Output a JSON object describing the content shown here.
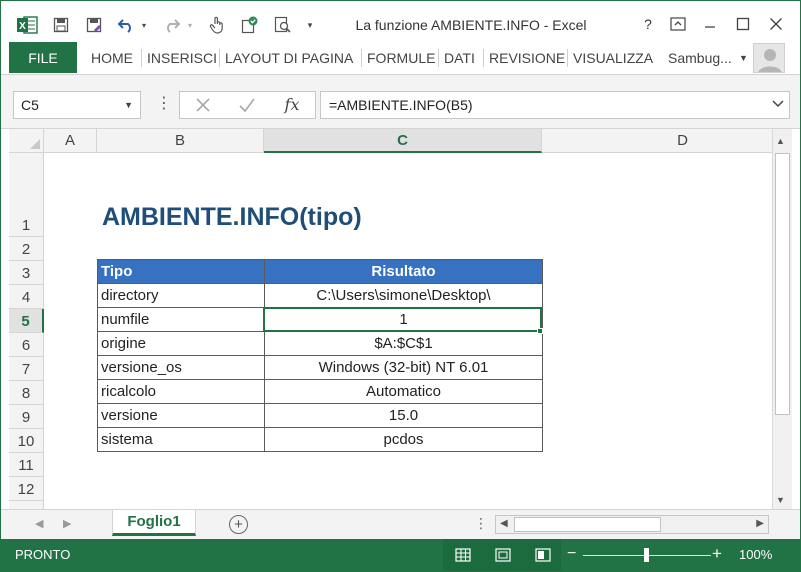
{
  "window": {
    "title": "La funzione AMBIENTE.INFO - Excel",
    "help_label": "?"
  },
  "ribbon": {
    "file_label": "FILE",
    "tabs": [
      "HOME",
      "INSERISCI",
      "LAYOUT DI PAGINA",
      "FORMULE",
      "DATI",
      "REVISIONE",
      "VISUALIZZA"
    ],
    "user_name": "Sambug..."
  },
  "formula_bar": {
    "name_box": "C5",
    "formula": "=AMBIENTE.INFO(B5)"
  },
  "grid": {
    "columns": [
      "A",
      "B",
      "C",
      "D"
    ],
    "active_column": "C",
    "rows": [
      "1",
      "2",
      "3",
      "4",
      "5",
      "6",
      "7",
      "8",
      "9",
      "10",
      "11",
      "12"
    ],
    "active_row": "5"
  },
  "sheet": {
    "title": "AMBIENTE.INFO(tipo)",
    "table_header": [
      "Tipo",
      "Risultato"
    ],
    "table_rows": [
      [
        "directory",
        "C:\\Users\\simone\\Desktop\\"
      ],
      [
        "numfile",
        "1"
      ],
      [
        "origine",
        "$A:$C$1"
      ],
      [
        "versione_os",
        "Windows (32-bit) NT 6.01"
      ],
      [
        "ricalcolo",
        "Automatico"
      ],
      [
        "versione",
        "15.0"
      ],
      [
        "sistema",
        "pcdos"
      ]
    ]
  },
  "tabs": {
    "sheet_name": "Foglio1"
  },
  "status": {
    "text": "PRONTO",
    "zoom": "100%",
    "zoom_level_percent": 100
  },
  "colors": {
    "excel_green": "#217346",
    "title_blue": "#1f4e79",
    "header_blue": "#3672c0"
  }
}
